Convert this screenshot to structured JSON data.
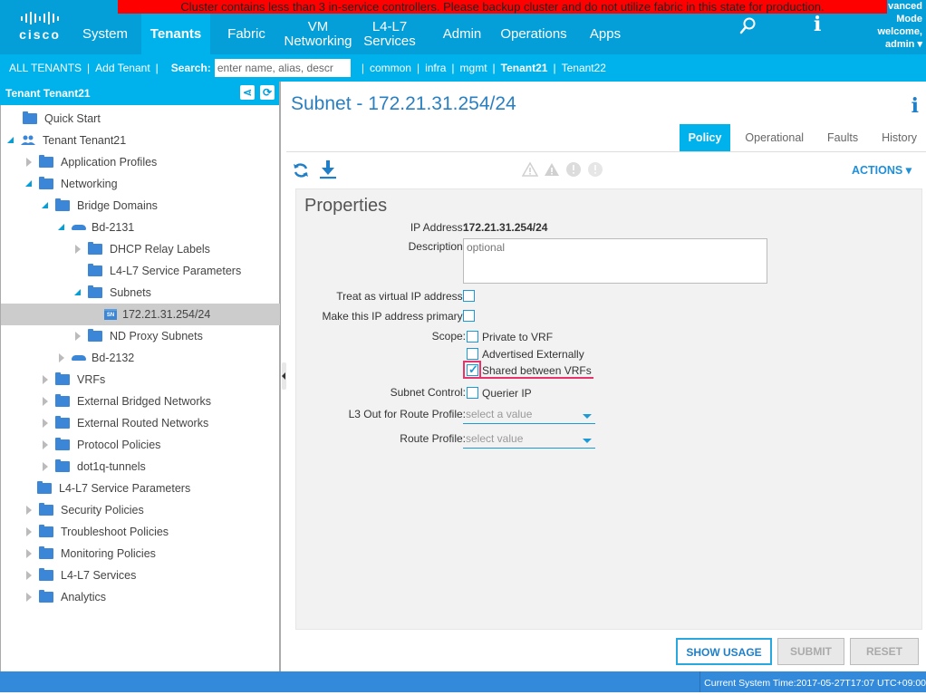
{
  "alert_banner": "Cluster contains less than 3 in-service controllers. Please backup cluster and do not utilize fabric in this state for production.",
  "logo": {
    "text": "cisco"
  },
  "nav": [
    {
      "label": "System"
    },
    {
      "label": "Tenants",
      "active": true
    },
    {
      "label": "Fabric"
    },
    {
      "label_line1": "VM",
      "label_line2": "Networking"
    },
    {
      "label_line1": "L4-L7",
      "label_line2": "Services"
    },
    {
      "label": "Admin"
    },
    {
      "label": "Operations"
    },
    {
      "label": "Apps"
    }
  ],
  "user": {
    "mode_line1": "vanced",
    "mode_line2": "Mode",
    "welcome": "welcome,",
    "name": "admin"
  },
  "icons": {
    "search": "search-icon",
    "info": "info-icon"
  },
  "subbar": {
    "all_tenants": "ALL TENANTS",
    "add_tenant": "Add Tenant",
    "search_label": "Search:",
    "search_placeholder": "enter name, alias, descr",
    "tenants": [
      "common",
      "infra",
      "mgmt",
      "Tenant21",
      "Tenant22"
    ]
  },
  "left_panel": {
    "title": "Tenant Tenant21",
    "tree": [
      {
        "label": "Quick Start"
      },
      {
        "label": "Tenant Tenant21"
      },
      {
        "label": "Application Profiles"
      },
      {
        "label": "Networking"
      },
      {
        "label": "Bridge Domains"
      },
      {
        "label": "Bd-2131"
      },
      {
        "label": "DHCP Relay Labels"
      },
      {
        "label": "L4-L7 Service Parameters"
      },
      {
        "label": "Subnets"
      },
      {
        "label": "172.21.31.254/24",
        "badge": "SN"
      },
      {
        "label": "ND Proxy Subnets"
      },
      {
        "label": "Bd-2132"
      },
      {
        "label": "VRFs"
      },
      {
        "label": "External Bridged Networks"
      },
      {
        "label": "External Routed Networks"
      },
      {
        "label": "Protocol Policies"
      },
      {
        "label": "dot1q-tunnels"
      },
      {
        "label": "L4-L7 Service Parameters"
      },
      {
        "label": "Security Policies"
      },
      {
        "label": "Troubleshoot Policies"
      },
      {
        "label": "Monitoring Policies"
      },
      {
        "label": "L4-L7 Services"
      },
      {
        "label": "Analytics"
      }
    ]
  },
  "main": {
    "title": "Subnet - 172.21.31.254/24",
    "tabs": [
      "Policy",
      "Operational",
      "Faults",
      "History"
    ],
    "active_tab": "Policy",
    "actions_label": "ACTIONS",
    "properties": {
      "title": "Properties",
      "ip_label": "IP Address:",
      "ip_value": "172.21.31.254/24",
      "desc_label": "Description:",
      "desc_placeholder": "optional",
      "virtual_ip_label": "Treat as virtual IP address:",
      "virtual_ip_checked": false,
      "primary_label": "Make this IP address primary:",
      "primary_checked": false,
      "scope_label": "Scope:",
      "scope_options": [
        {
          "label": "Private to VRF",
          "checked": false
        },
        {
          "label": "Advertised Externally",
          "checked": false
        },
        {
          "label": "Shared between VRFs",
          "checked": true
        }
      ],
      "subnet_control_label": "Subnet Control:",
      "querier_label": "Querier IP",
      "querier_checked": false,
      "l3out_label": "L3 Out for Route Profile:",
      "l3out_placeholder": "select a value",
      "route_profile_label": "Route Profile:",
      "route_profile_placeholder": "select value"
    },
    "buttons": {
      "show_usage": "SHOW USAGE",
      "submit": "SUBMIT",
      "reset": "RESET"
    }
  },
  "footer": {
    "time": "Current System Time:2017-05-27T17:07 UTC+09:00"
  },
  "colors": {
    "header": "#049fd9",
    "subbar": "#00b2eb",
    "alert": "#ff0000",
    "footer": "#338adb",
    "highlight": "#e8336b"
  }
}
